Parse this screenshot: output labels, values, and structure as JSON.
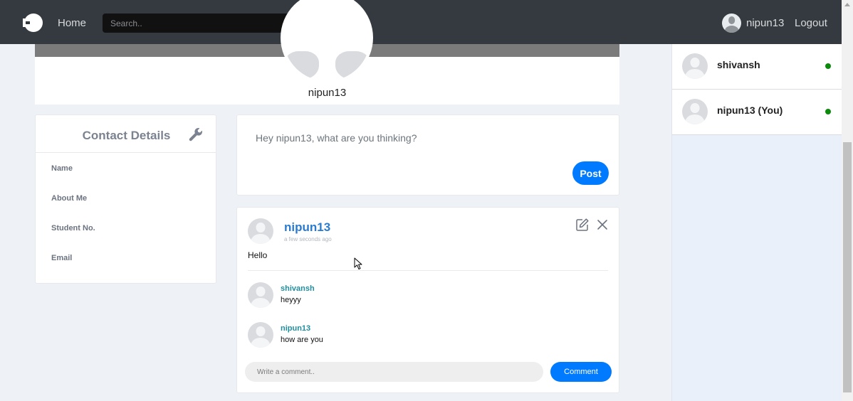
{
  "navbar": {
    "home_label": "Home",
    "search_placeholder": "Search..",
    "username": "nipun13",
    "logout_label": "Logout"
  },
  "profile": {
    "name": "nipun13"
  },
  "contact": {
    "title": "Contact Details",
    "fields": [
      "Name",
      "About Me",
      "Student No.",
      "Email"
    ]
  },
  "composer": {
    "placeholder": "Hey nipun13, what are you thinking?",
    "post_label": "Post"
  },
  "post": {
    "author": "nipun13",
    "time": "a few seconds ago",
    "text": "Hello",
    "comments": [
      {
        "author": "shivansh",
        "text": "heyyy"
      },
      {
        "author": "nipun13",
        "text": "how are you"
      }
    ],
    "comment_placeholder": "Write a comment..",
    "comment_label": "Comment"
  },
  "online_users": [
    {
      "name": "shivansh",
      "status_color": "#0c8a0c"
    },
    {
      "name": "nipun13 (You)",
      "status_color": "#0c8a0c"
    }
  ],
  "colors": {
    "navbar": "#343a40",
    "accent": "#007bff",
    "online": "#0c8a0c"
  }
}
